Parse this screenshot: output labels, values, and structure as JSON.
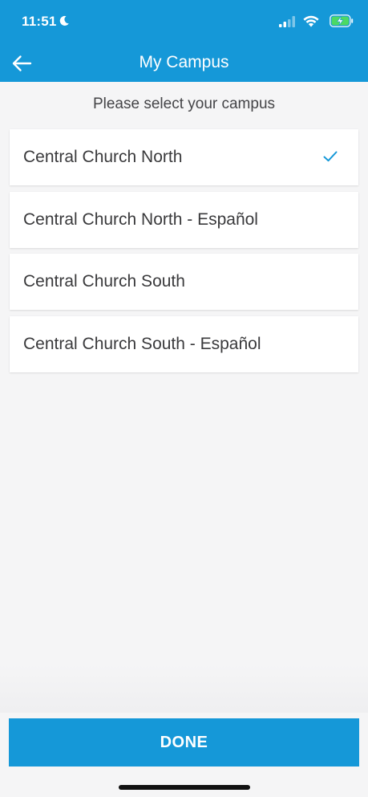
{
  "status_bar": {
    "time": "11:51"
  },
  "nav": {
    "title": "My Campus"
  },
  "prompt": "Please select your campus",
  "campuses": [
    {
      "label": "Central Church North",
      "selected": true
    },
    {
      "label": "Central Church North - Español",
      "selected": false
    },
    {
      "label": "Central Church South",
      "selected": false
    },
    {
      "label": "Central Church South - Español",
      "selected": false
    }
  ],
  "done_label": "DONE",
  "colors": {
    "accent": "#1598d8",
    "background": "#f5f5f6",
    "text": "#3a3a3c",
    "battery_green": "#4cd964"
  }
}
